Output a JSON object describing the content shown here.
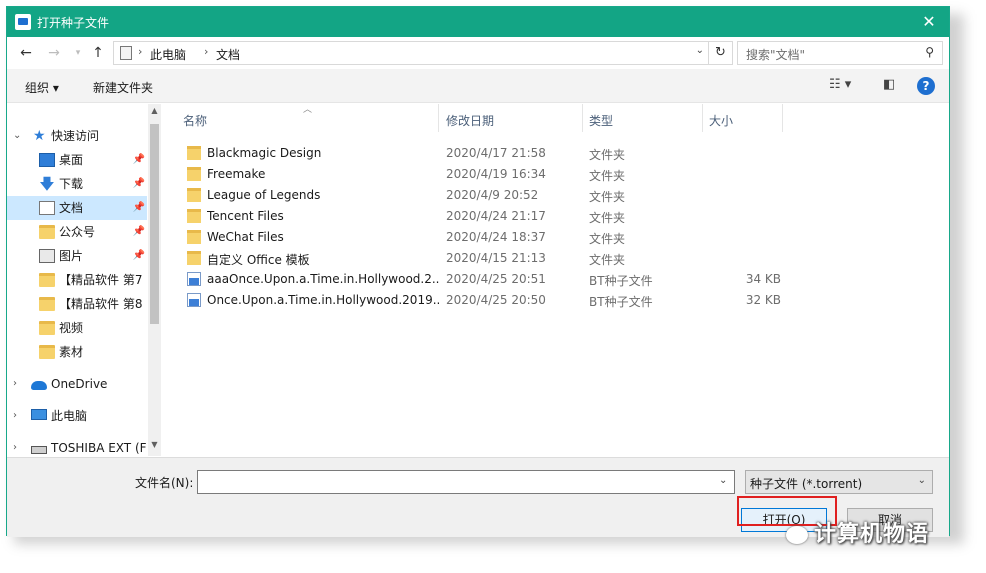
{
  "window": {
    "title": "打开种子文件",
    "close_glyph": "✕"
  },
  "nav": {
    "breadcrumb": [
      "此电脑",
      "文档"
    ],
    "search_placeholder": "搜索\"文档\""
  },
  "toolbar": {
    "organize": "组织 ▾",
    "new_folder": "新建文件夹"
  },
  "sidebar": {
    "items": [
      {
        "label": "快速访问",
        "icon": "star-icon"
      },
      {
        "label": "桌面",
        "icon": "desktop-icon",
        "pinned": true
      },
      {
        "label": "下载",
        "icon": "download-icon",
        "pinned": true
      },
      {
        "label": "文档",
        "icon": "document-icon",
        "pinned": true,
        "selected": true
      },
      {
        "label": "公众号",
        "icon": "folder-icon",
        "pinned": true
      },
      {
        "label": "图片",
        "icon": "pictures-icon",
        "pinned": true
      },
      {
        "label": "【精品软件 第7",
        "icon": "folder-icon"
      },
      {
        "label": "【精品软件 第8",
        "icon": "folder-icon"
      },
      {
        "label": "视频",
        "icon": "folder-icon"
      },
      {
        "label": "素材",
        "icon": "folder-icon"
      },
      {
        "label": "OneDrive",
        "icon": "onedrive-icon"
      },
      {
        "label": "此电脑",
        "icon": "computer-icon"
      },
      {
        "label": "TOSHIBA EXT (F",
        "icon": "drive-icon"
      }
    ]
  },
  "columns": {
    "name": "名称",
    "date": "修改日期",
    "type": "类型",
    "size": "大小"
  },
  "files": [
    {
      "name": "Blackmagic Design",
      "date": "2020/4/17 21:58",
      "type": "文件夹",
      "size": "",
      "icon": "folder-icon"
    },
    {
      "name": "Freemake",
      "date": "2020/4/19 16:34",
      "type": "文件夹",
      "size": "",
      "icon": "folder-icon"
    },
    {
      "name": "League of Legends",
      "date": "2020/4/9 20:52",
      "type": "文件夹",
      "size": "",
      "icon": "folder-icon"
    },
    {
      "name": "Tencent Files",
      "date": "2020/4/24 21:17",
      "type": "文件夹",
      "size": "",
      "icon": "folder-icon"
    },
    {
      "name": "WeChat Files",
      "date": "2020/4/24 18:37",
      "type": "文件夹",
      "size": "",
      "icon": "folder-icon"
    },
    {
      "name": "自定义 Office 模板",
      "date": "2020/4/15 21:13",
      "type": "文件夹",
      "size": "",
      "icon": "folder-icon"
    },
    {
      "name": "aaaOnce.Upon.a.Time.in.Hollywood.2...",
      "date": "2020/4/25 20:51",
      "type": "BT种子文件",
      "size": "34 KB",
      "icon": "torrent-icon"
    },
    {
      "name": "Once.Upon.a.Time.in.Hollywood.2019...",
      "date": "2020/4/25 20:50",
      "type": "BT种子文件",
      "size": "32 KB",
      "icon": "torrent-icon"
    }
  ],
  "footer": {
    "filename_label": "文件名(N):",
    "filename_value": "",
    "filetype": "种子文件 (*.torrent)",
    "open": "打开(O)",
    "cancel": "取消"
  },
  "watermark": "计算机物语",
  "colors": {
    "titlebar": "#13a585",
    "selection": "#cce8ff",
    "highlight": "#e02020"
  }
}
